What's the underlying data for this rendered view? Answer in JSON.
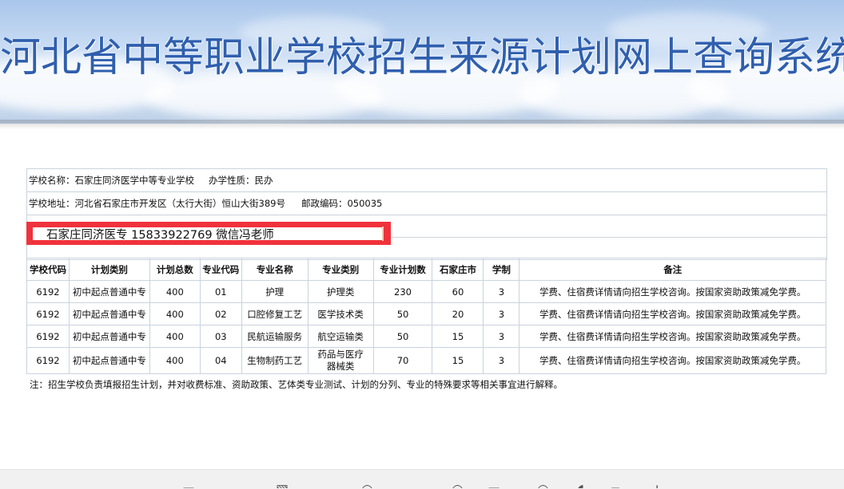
{
  "header": {
    "title": "河北省中等职业学校招生来源计划网上查询系统"
  },
  "school": {
    "name_label": "学校名称：石家庄同济医学中等专业学校",
    "nature_label": "办学性质：民办",
    "address_label": "学校地址：河北省石家庄市开发区（太行大街）恒山大街389号",
    "postcode_label": "邮政编码：050035"
  },
  "overlay": {
    "text": "石家庄同济医专 15833922769 微信冯老师",
    "color": "#f0323c"
  },
  "plan_table": {
    "headers": [
      "学校代码",
      "计划类别",
      "计划总数",
      "专业代码",
      "专业名称",
      "专业类别",
      "专业计划数",
      "石家庄市",
      "学制",
      "备注"
    ],
    "rows": [
      [
        "6192",
        "初中起点普通中专",
        "400",
        "01",
        "护理",
        "护理类",
        "230",
        "60",
        "3",
        "学费、住宿费详情请向招生学校咨询。按国家资助政策减免学费。"
      ],
      [
        "6192",
        "初中起点普通中专",
        "400",
        "02",
        "口腔修复工艺",
        "医学技术类",
        "50",
        "20",
        "3",
        "学费、住宿费详情请向招生学校咨询。按国家资助政策减免学费。"
      ],
      [
        "6192",
        "初中起点普通中专",
        "400",
        "03",
        "民航运输服务",
        "航空运输类",
        "50",
        "15",
        "3",
        "学费、住宿费详情请向招生学校咨询。按国家资助政策减免学费。"
      ],
      [
        "6192",
        "初中起点普通中专",
        "400",
        "04",
        "生物制药工艺",
        "药品与医疗器械类",
        "70",
        "15",
        "3",
        "学费、住宿费详情请向招生学校咨询。按国家资助政策减免学费。"
      ]
    ]
  },
  "footnote": "注：招生学校负责填报招生计划，并对收费标准、资助政策、艺体类专业测试、计划的分列、专业的特殊要求等相关事宜进行解释。",
  "colors": {
    "title": "#2f5fae",
    "border": "#c9d3de"
  }
}
